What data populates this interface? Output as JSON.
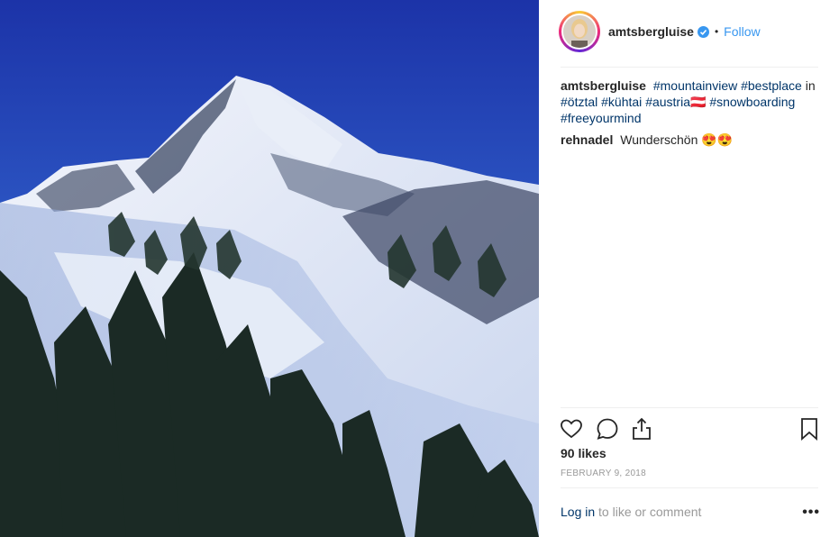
{
  "post": {
    "username": "amtsbergluise",
    "separator": "•",
    "follow_label": "Follow",
    "caption": {
      "user": "amtsbergluise",
      "parts": [
        "#mountainview",
        "#bestplace",
        "in",
        "#ötztal",
        "#kühtai",
        "#austria🇦🇹",
        "#snowboarding",
        "#freeyourmind"
      ]
    },
    "comment": {
      "user": "rehnadel",
      "text": "Wunderschön 😍😍"
    },
    "likes": "90 likes",
    "date": "FEBRUARY 9, 2018",
    "login_link": "Log in",
    "login_rest": "to like or comment",
    "more_label": "•••"
  },
  "icons": [
    "heart-icon",
    "comment-icon",
    "share-icon",
    "bookmark-icon",
    "verified-badge-icon",
    "more-options-icon"
  ],
  "colors": {
    "link_blue": "#3897f0",
    "hashtag": "#003569",
    "muted": "#999999",
    "divider": "#efefef"
  }
}
